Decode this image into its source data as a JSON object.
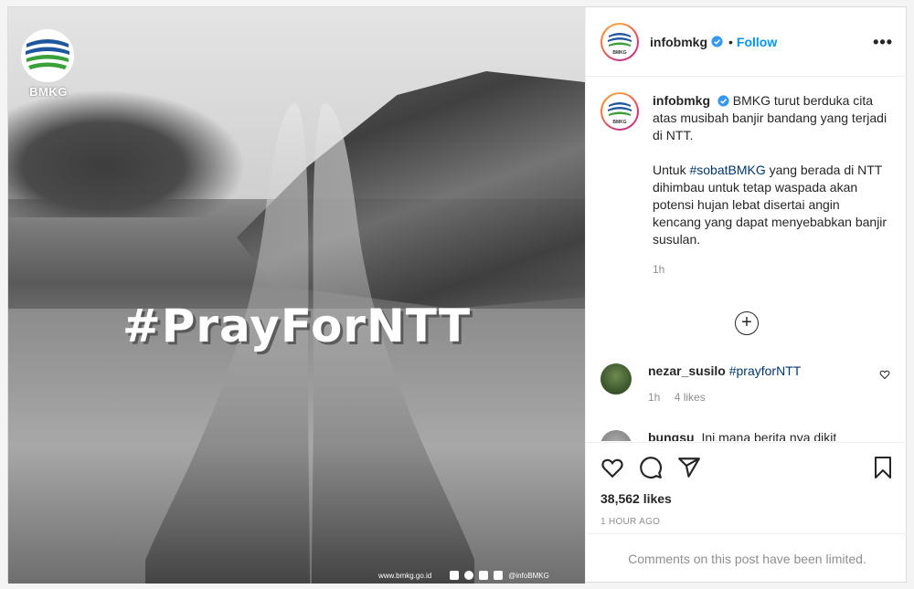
{
  "post": {
    "username": "infobmkg",
    "follow_label": "Follow",
    "dot": "•",
    "more_label": "•••"
  },
  "media": {
    "logo_text": "BMKG",
    "hashtag": "#PrayForNTT",
    "website": "www.bmkg.go.id",
    "social_handle": "@infoBMKG"
  },
  "caption": {
    "username": "infobmkg",
    "text_p1": "BMKG turut berduka cita atas musibah banjir bandang yang terjadi di NTT.",
    "text_p2_pre": "Untuk ",
    "text_p2_tag": "#sobatBMKG",
    "text_p2_post": " yang berada di NTT dihimbau untuk tetap waspada akan potensi hujan lebat disertai angin kencang yang dapat menyebabkan banjir susulan.",
    "time": "1h"
  },
  "comments": [
    {
      "username": "nezar_susilo",
      "tag": "#prayforNTT",
      "time": "1h",
      "likes": "4 likes"
    },
    {
      "username": "bungsu",
      "text": "Ini mana berita nya dikit"
    }
  ],
  "stats": {
    "likes": "38,562 likes",
    "posted": "1 HOUR AGO",
    "limited_notice": "Comments on this post have been limited."
  },
  "colors": {
    "accent": "#0095f6",
    "hashtag_link": "#00376b",
    "muted": "#8e8e8e"
  }
}
